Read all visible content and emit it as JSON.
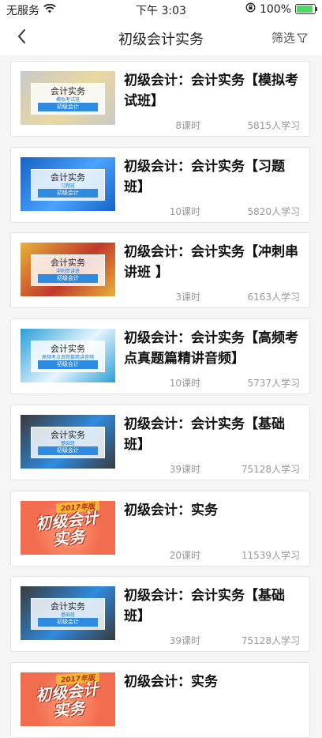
{
  "status_bar": {
    "carrier": "无服务",
    "time": "下午 3:03",
    "battery_text": "100%",
    "battery_level": 1.0
  },
  "nav": {
    "title": "初级会计实务",
    "filter_label": "筛选"
  },
  "courses": [
    {
      "title": "初级会计：会计实务【模拟考试班】",
      "lessons": "8课时",
      "students": "5815人学习",
      "thumb": {
        "type": "banner",
        "line1": "会计实务",
        "line2": "模拟考试班",
        "bar": "初级会计",
        "bg": "#c9c9c9",
        "accent": "#e9d8a0"
      }
    },
    {
      "title": "初级会计：会计实务【习题班】",
      "lessons": "10课时",
      "students": "5820人学习",
      "thumb": {
        "type": "banner",
        "line1": "会计实务",
        "line2": "习题班",
        "bar": "初级会计",
        "bg": "#1763c4",
        "accent": "#4aa3ff"
      }
    },
    {
      "title": "初级会计：会计实务【冲刺串讲班 】",
      "lessons": "3课时",
      "students": "6163人学习",
      "thumb": {
        "type": "banner",
        "line1": "会计实务",
        "line2": "冲刺串讲班",
        "bar": "初级会计",
        "bg": "#e8b13a",
        "accent": "#c0392b"
      }
    },
    {
      "title": "初级会计：会计实务【高频考点真题篇精讲音频】",
      "lessons": "10课时",
      "students": "5737人学习",
      "thumb": {
        "type": "banner",
        "line1": "会计实务",
        "line2": "高频考点真题篇精讲音频",
        "bar": "初级会计",
        "bg": "#2a9fd6",
        "accent": "#e8f6ff"
      }
    },
    {
      "title": "初级会计：会计实务【基础班】",
      "lessons": "39课时",
      "students": "75128人学习",
      "thumb": {
        "type": "banner",
        "line1": "会计实务",
        "line2": "基础班",
        "bar": "初级会计",
        "bg": "#3a3a3a",
        "accent": "#2f8be0"
      }
    },
    {
      "title": "初级会计：实务",
      "lessons": "20课时",
      "students": "11539人学习",
      "thumb": {
        "type": "promo",
        "top": "2017年版",
        "line1": "初级会计",
        "line2": "实务",
        "bg": "#f26c4f"
      }
    },
    {
      "title": "初级会计：会计实务【基础班】",
      "lessons": "39课时",
      "students": "75128人学习",
      "thumb": {
        "type": "banner",
        "line1": "会计实务",
        "line2": "基础班",
        "bar": "初级会计",
        "bg": "#3a3a3a",
        "accent": "#2f8be0"
      }
    },
    {
      "title": "初级会计：实务",
      "lessons": "",
      "students": "",
      "thumb": {
        "type": "promo",
        "top": "2017年版",
        "line1": "初级会计",
        "line2": "实务",
        "bg": "#f26c4f"
      }
    }
  ]
}
